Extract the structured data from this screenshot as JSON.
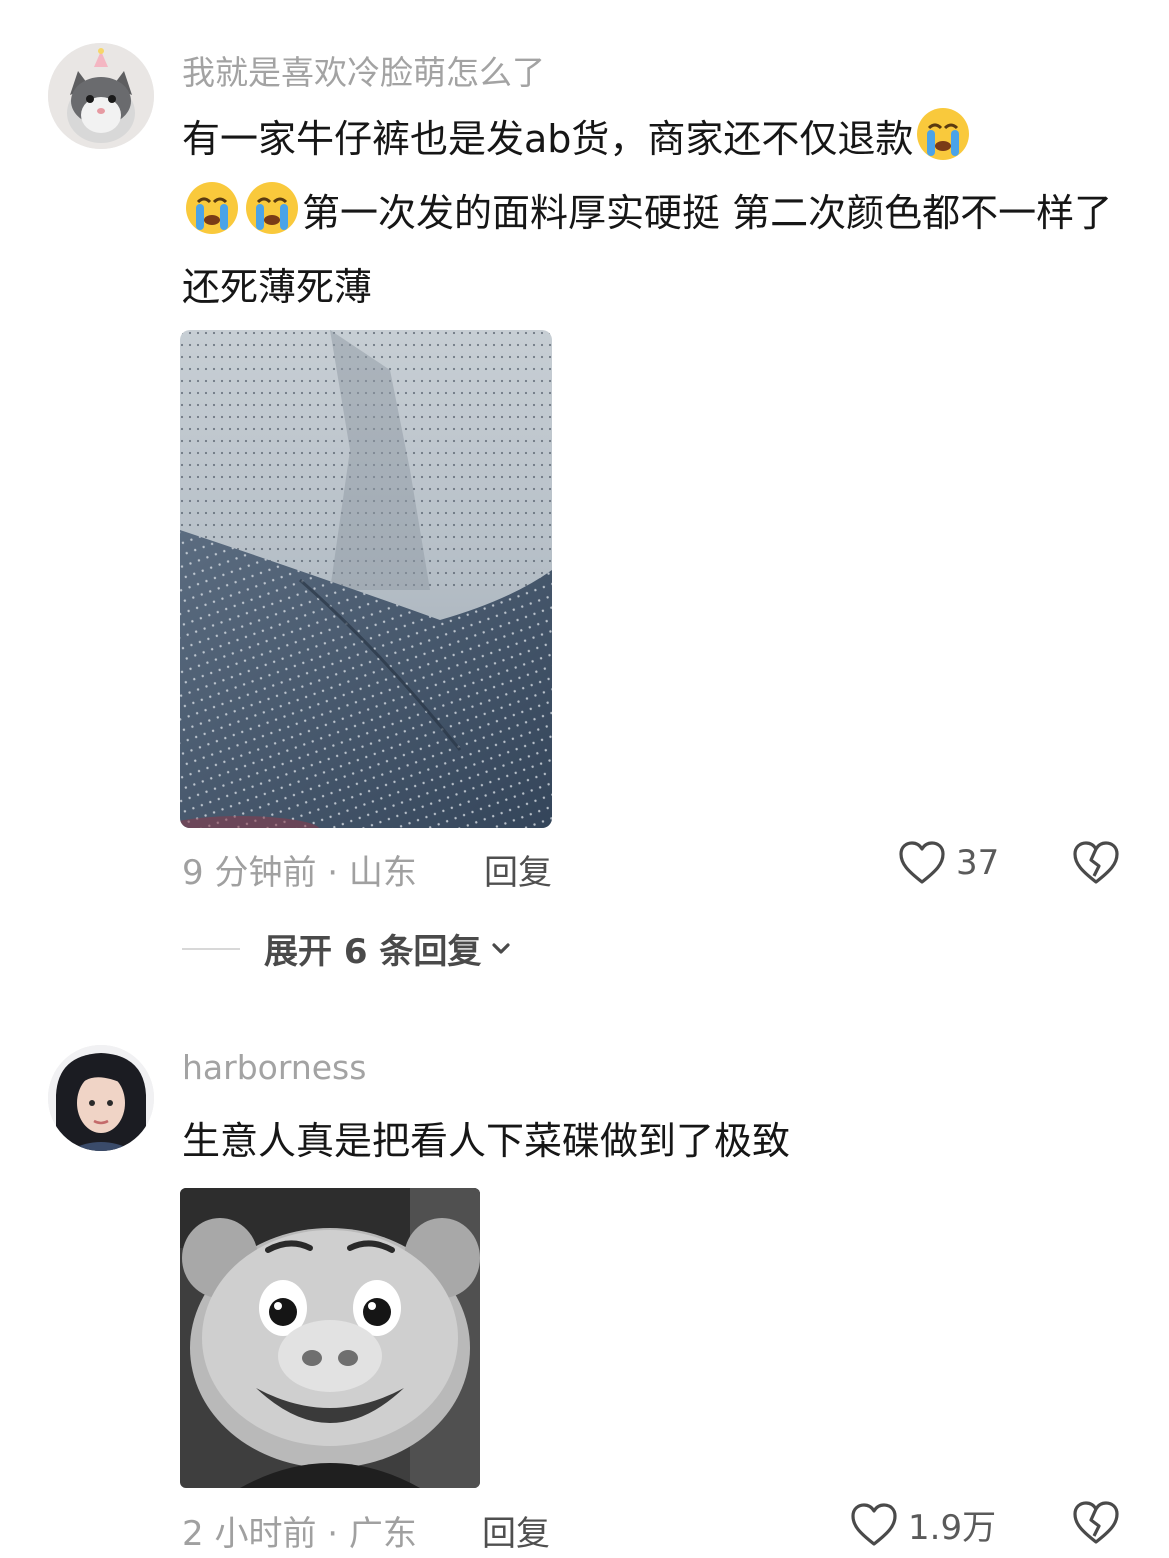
{
  "comments": [
    {
      "username": "我就是喜欢冷脸萌怎么了",
      "text_part1": "有一家牛仔裤也是发ab货，商家还不仅退款",
      "text_part2": "第一次发的面料厚实硬挺 第二次颜色都不一样了还死薄死薄",
      "emojis": [
        "crying-emoji",
        "crying-emoji",
        "crying-emoji"
      ],
      "time_location": "9 分钟前 · 山东",
      "reply_label": "回复",
      "like_count": "37",
      "expand_label": "展开 6 条回复"
    },
    {
      "username": "harborness",
      "text": "生意人真是把看人下菜碟做到了极致",
      "time_location": "2 小时前 · 广东",
      "reply_label": "回复",
      "like_count": "1.9万"
    }
  ],
  "icons": {
    "like": "heart-outline-icon",
    "dislike": "broken-heart-icon",
    "expand": "chevron-down-icon"
  },
  "colors": {
    "username": "#a3a3a3",
    "meta": "#a0a0a0",
    "text": "#161616"
  }
}
